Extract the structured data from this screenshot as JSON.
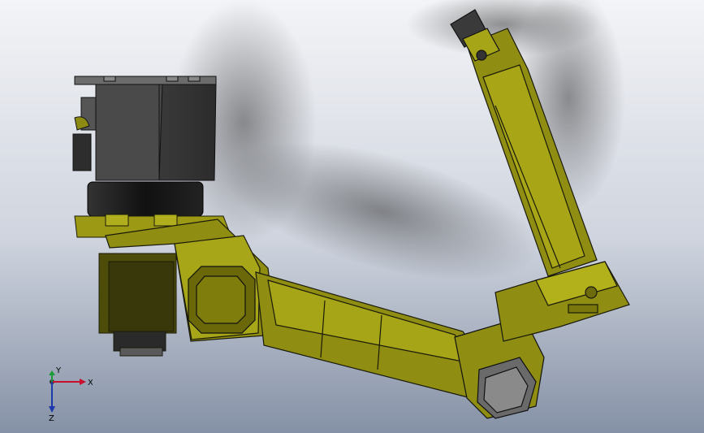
{
  "view": {
    "background_top": "#f2f3f6",
    "background_mid": "#c9ced9",
    "background_bottom": "#7f8ba0",
    "part_color": "#8f8d12",
    "part_highlight": "#b7b51d",
    "part_shadow": "#5e5c08",
    "motor_color": "#3b3b3b",
    "edge_color": "#1a1a0a"
  },
  "triad": {
    "x_label": "X",
    "y_label": "Y",
    "z_label": "Z",
    "x_color": "#c8102e",
    "y_color": "#1d9a3a",
    "z_color": "#1c3aa9"
  }
}
